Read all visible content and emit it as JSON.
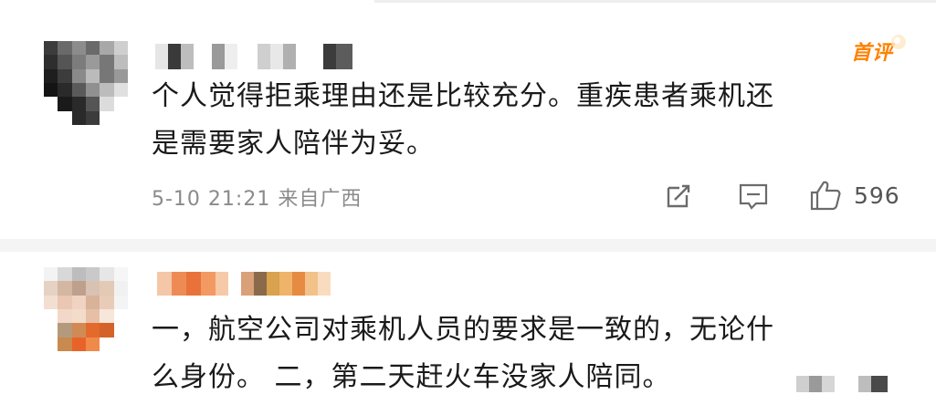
{
  "comments": [
    {
      "text_line1": "个人觉得拒乘理由还是比较充分。重疾患者乘机还",
      "text_line2": "是需要家人陪伴为妥。",
      "badge": "首评",
      "date": "5-10 21:21",
      "location": "来自广西",
      "likes": "596",
      "icons": [
        "share-icon",
        "comment-icon",
        "like-icon"
      ]
    },
    {
      "text_line1": "一，航空公司对乘机人员的要求是一致的，无论什",
      "text_line2": "么身份。 二，第二天赶火车没家人陪同。"
    }
  ],
  "colors": {
    "badge": "#ff8200",
    "meta_text": "#8a8a8a",
    "divider": "#f4f4f4"
  }
}
